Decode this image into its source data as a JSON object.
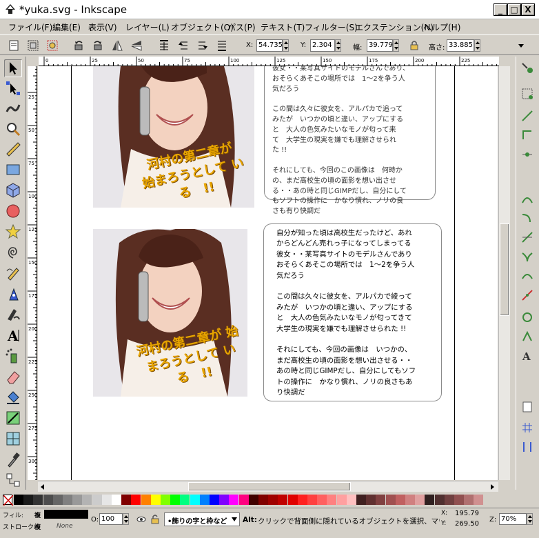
{
  "window": {
    "title": "*yuka.svg - Inkscape",
    "minimize": "_",
    "maximize": "□",
    "close": "X"
  },
  "menu": [
    "ファイル(F)",
    "編集(E)",
    "表示(V)",
    "レイヤー(L)",
    "オブジェクト(O)",
    "パス(P)",
    "テキスト(T)",
    "フィルター(S)",
    "エクステンション(N)",
    "ヘルプ(H)"
  ],
  "toolbar": {
    "x_label": "X:",
    "x_value": "54.735",
    "y_label": "Y:",
    "y_value": "2.304",
    "w_label": "幅:",
    "w_value": "39.779",
    "h_label": "高さ:",
    "h_value": "33.885"
  },
  "ruler": {
    "h_ticks": [
      "0",
      "25",
      "50",
      "75",
      "100",
      "125",
      "150",
      "175",
      "200",
      "225"
    ],
    "v_ticks": [
      "0",
      "25",
      "50",
      "75",
      "100",
      "125",
      "150",
      "175",
      "200",
      "225",
      "250",
      "275",
      "300"
    ]
  },
  "canvas": {
    "card1_text": "彼女・・某写真サイトのモデルさんであり、\nおそらくあそこの場所では　1〜2を争う人\n気だろう\n\nこの間は久々に彼女を、アルパカで追って\nみたが　いつかの頃と違い、アップにする\nと　大人の色気みたいなモノが匂って来\nて　大学生の現実を嫌でも理解させられ\nた !!\n\nそれにしても、今回のこの画像は　何時か\nの、まだ高校生の頃の面影を想い出させ\nる・・あの時と同じGIMPだし、自分にして\nもソフトの操作に　かなり慣れ、ノリの良\nさも有り快調だ",
    "card2_text": "自分が知った頃は高校生だったけど、あれ\nからどんどん売れっ子になってしまってる\n彼女・・某写真サイトのモデルさんであり\nおそらくあそこの場所では　1〜2を争う人\n気だろう\n\nこの間は久々に彼女を、アルパカで綾って\nみたが　いつかの頃と違い、アップにする\nと　大人の色気みたいなモノが匂ってきて\n大学生の現実を嫌でも理解させられた !!\n\nそれにしても、今回の画像は　いつかの、\nまだ高校生の頃の面影を想い出させる・・\nあの時と同じGIMPだし、自分にしてもソフ\nトの操作に　かなり慣れ、ノリの良さもあ\nり快調だ",
    "overlay1": "河村の第二章が\n始まろうとして\nいる　!!",
    "overlay2": "河村の第二章が\n始まろうとして\nいる　!!"
  },
  "status": {
    "fill_label": "フィル:",
    "fill_value": "複",
    "stroke_label": "ストローク:",
    "stroke_value": "複",
    "stroke_none": "None",
    "opacity_label": "O:",
    "opacity_value": "100",
    "layer": "•飾りの字と枠など",
    "message_bold": "Alt:",
    "message": " クリックで背面側に隠れているオブジェクトを選択、マウス...",
    "x_label": "X:",
    "x_value": "195.79",
    "y_label": "Y:",
    "y_value": "269.50",
    "zoom_label": "Z:",
    "zoom_value": "70%"
  },
  "colors": {
    "overlay_text": "#e8a500",
    "palette": [
      "#000000",
      "#1a1a1a",
      "#333333",
      "#4d4d4d",
      "#666666",
      "#808080",
      "#999999",
      "#b3b3b3",
      "#cccccc",
      "#e6e6e6",
      "#ffffff",
      "#800000",
      "#ff0000",
      "#ff8000",
      "#ffff00",
      "#80ff00",
      "#00ff00",
      "#00ff80",
      "#00ffff",
      "#0080ff",
      "#0000ff",
      "#8000ff",
      "#ff00ff",
      "#ff0080",
      "#400000",
      "#800000",
      "#a00000",
      "#c00000",
      "#e00000",
      "#ff2020",
      "#ff4040",
      "#ff6060",
      "#ff8080",
      "#ffa0a0",
      "#ffc0c0",
      "#402020",
      "#603030",
      "#804040",
      "#a05050",
      "#c06060",
      "#d08080",
      "#e0a0a0",
      "#302020",
      "#503030",
      "#704040",
      "#905050",
      "#b07070",
      "#d09090"
    ]
  }
}
